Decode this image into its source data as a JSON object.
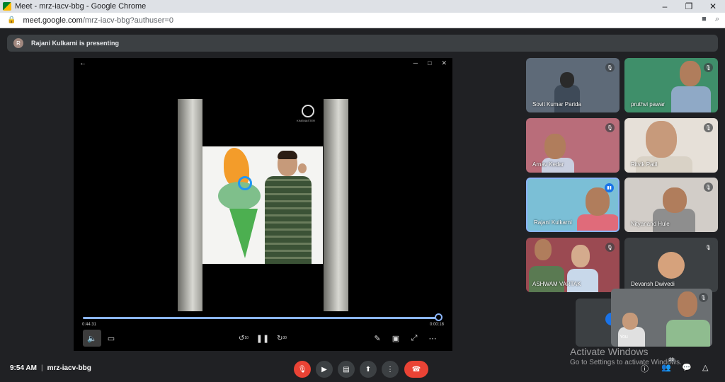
{
  "browser": {
    "window_title": "Meet - mrz-iacv-bbg - Google Chrome",
    "url_host": "meet.google.com",
    "url_path": "/mrz-iacv-bbg?authuser=0",
    "minimize": "–",
    "restore": "❐",
    "close": "✕"
  },
  "banner": {
    "avatar_letter": "R",
    "text": "Rajani Kulkarni is presenting"
  },
  "presentation": {
    "watermark": "KINEMASTER",
    "time_elapsed": "0:44:31",
    "time_total": "0:00:18",
    "progress_fraction": 1.0,
    "rewind_seconds": "10",
    "forward_seconds": "30"
  },
  "participants": [
    {
      "name": "Sovit Kumar Parida",
      "muted": true
    },
    {
      "name": "pruthvi pawar",
      "muted": true
    },
    {
      "name": "Arnav Kedar",
      "muted": true
    },
    {
      "name": "Ritvik Patil",
      "muted": true
    },
    {
      "name": "Rajani Kulkarni",
      "muted": false,
      "speaking": true
    },
    {
      "name": "Nityanand Hule",
      "muted": true
    },
    {
      "name": "ASHWAM VARTAK",
      "muted": true
    },
    {
      "name": "Devansh Dwivedi",
      "muted": true
    }
  ],
  "self_view": {
    "name": "You"
  },
  "bottom": {
    "time": "9:54 AM",
    "separator": "|",
    "meeting_code": "mrz-iacv-bbg",
    "people_count": "28"
  },
  "watermark": {
    "line1": "Activate Windows",
    "line2": "Go to Settings to activate Windows."
  },
  "colors": {
    "end_call": "#ea4335",
    "accent": "#8ab4f8",
    "background": "#202124"
  }
}
